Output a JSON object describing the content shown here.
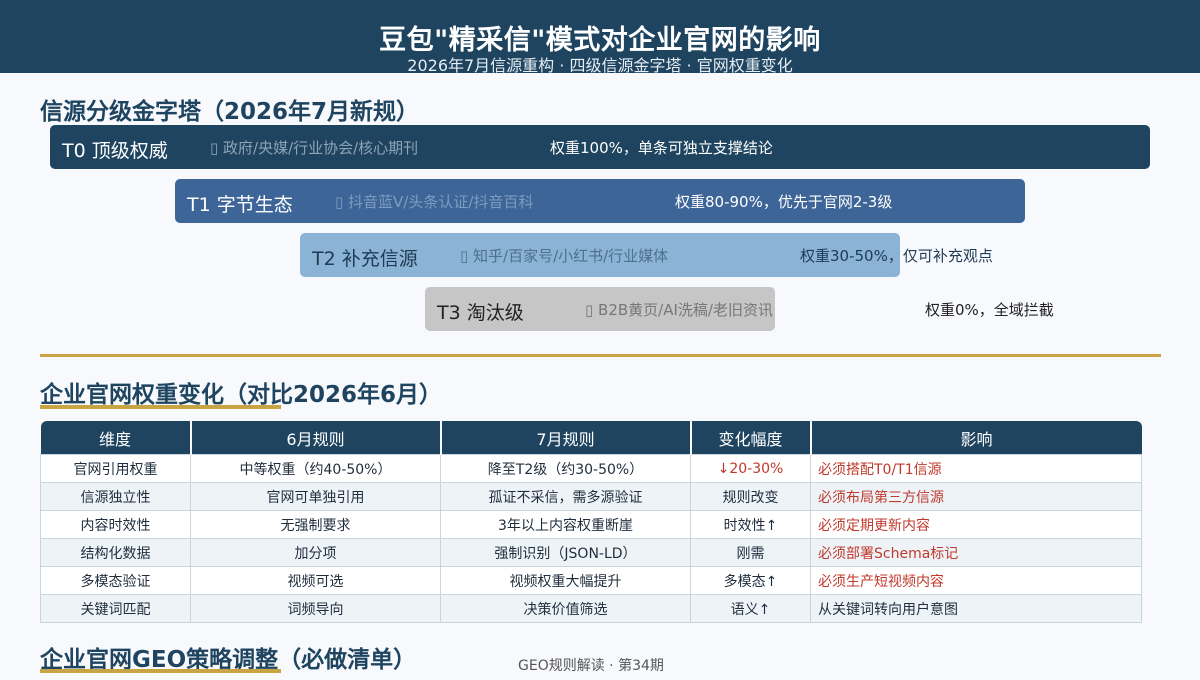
{
  "header": {
    "title": "豆包\"精采信\"模式对企业官网的影响",
    "subtitle": "2026年7月信源重构 · 四级信源金字塔 · 官网权重变化"
  },
  "pyramid": {
    "title": "信源分级金字塔（2026年7月新规）",
    "levels": [
      {
        "level": "T0 顶级权威",
        "sources": "▯ 政府/央媒/行业协会/核心期刊",
        "weight": "权重100%，单条可独立支撑结论",
        "color": "#1e4460"
      },
      {
        "level": "T1 字节生态",
        "sources": "▯ 抖音蓝V/头条认证/抖音百科",
        "weight": "权重80-90%，优先于官网2-3级",
        "color": "#3d6598"
      },
      {
        "level": "T2 补充信源",
        "sources": "▯ 知乎/百家号/小红书/行业媒体",
        "weight": "权重30-50%，仅可补充观点",
        "color": "#8ab3d5"
      },
      {
        "level": "T3 淘汰级",
        "sources": "▯ B2B黄页/AI洗稿/老旧资讯",
        "weight": "权重0%，全域拦截",
        "color": "#c6c6c6"
      }
    ]
  },
  "comparison": {
    "title": "企业官网权重变化（对比2026年6月）",
    "columns": [
      "维度",
      "6月规则",
      "7月规则",
      "变化幅度",
      "影响"
    ],
    "rows": [
      [
        "官网引用权重",
        "中等权重（约40-50%）",
        "降至T2级（约30-50%）",
        "↓20-30%",
        "必须搭配T0/T1信源"
      ],
      [
        "信源独立性",
        "官网可单独引用",
        "孤证不采信，需多源验证",
        "规则改变",
        "必须布局第三方信源"
      ],
      [
        "内容时效性",
        "无强制要求",
        "3年以上内容权重断崖",
        "时效性↑",
        "必须定期更新内容"
      ],
      [
        "结构化数据",
        "加分项",
        "强制识别（JSON-LD）",
        "刚需",
        "必须部署Schema标记"
      ],
      [
        "多模态验证",
        "视频可选",
        "视频权重大幅提升",
        "多模态↑",
        "必须生产短视频内容"
      ],
      [
        "关键词匹配",
        "词频导向",
        "决策价值筛选",
        "语义↑",
        "从关键词转向用户意图"
      ]
    ]
  },
  "strategy": {
    "title": "企业官网GEO策略调整（必做清单）"
  },
  "footer": {
    "text": "GEO规则解读 · 第34期"
  }
}
